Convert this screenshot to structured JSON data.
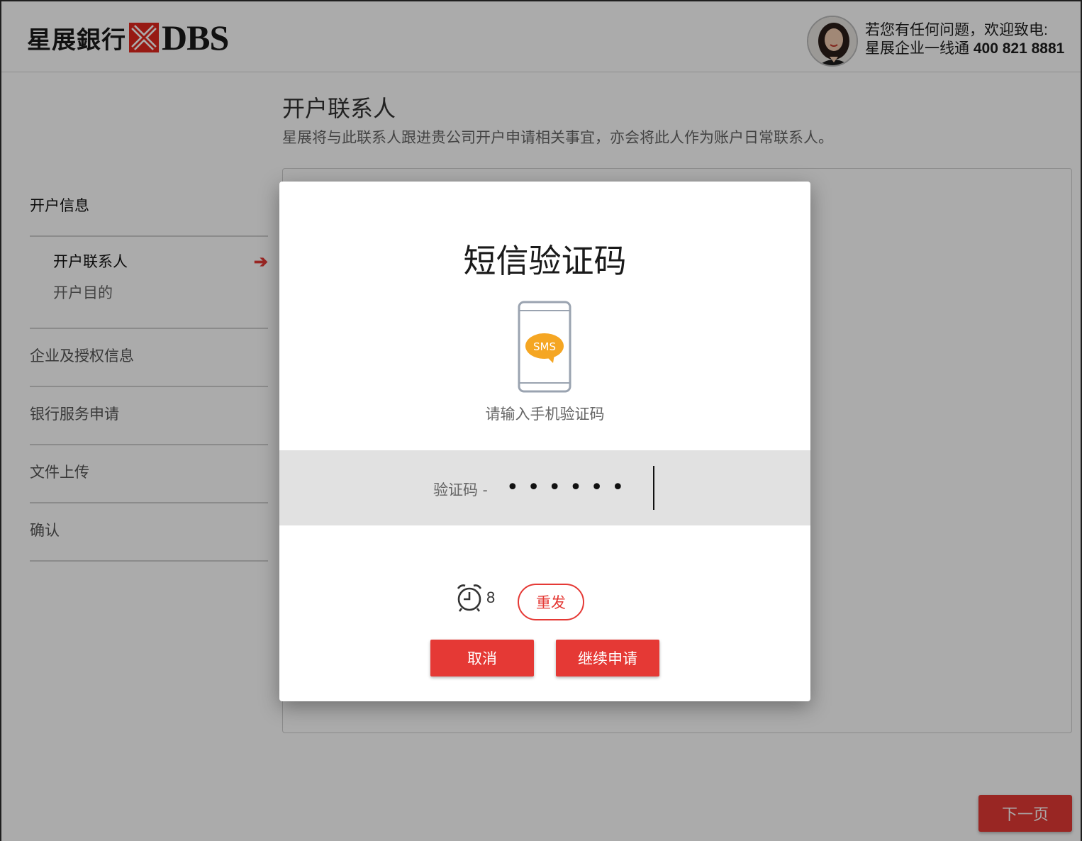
{
  "header": {
    "logo_cn": "星展銀行",
    "logo_en": "DBS",
    "contact_line1": "若您有任何问题，欢迎致电:",
    "contact_line2_prefix": "星展企业一线通",
    "contact_phone": "400 821 8881"
  },
  "page": {
    "title": "开户联系人",
    "subtitle": "星展将与此联系人跟进贵公司开户申请相关事宜，亦会将此人作为账户日常联系人。",
    "next_button": "下一页"
  },
  "sidebar": {
    "sections": [
      {
        "label": "开户信息",
        "active": true
      },
      {
        "label": "企业及授权信息"
      },
      {
        "label": "银行服务申请"
      },
      {
        "label": "文件上传"
      },
      {
        "label": "确认"
      }
    ],
    "sub_items": [
      {
        "label": "开户联系人",
        "current": true
      },
      {
        "label": "开户目的"
      }
    ]
  },
  "modal": {
    "title": "短信验证码",
    "sms_badge": "SMS",
    "prompt": "请输入手机验证码",
    "code_label": "验证码 -",
    "code_value": "••••••",
    "timer_count": "8",
    "resend_button": "重发",
    "cancel_button": "取消",
    "continue_button": "继续申请"
  },
  "colors": {
    "accent": "#e53935",
    "overlay": "rgba(0,0,0,0.33)",
    "sms_bubble": "#f5a623"
  },
  "icons": [
    "dbs-x-logo-icon",
    "avatar",
    "arrow-right-icon",
    "phone-sms-icon",
    "alarm-clock-icon"
  ]
}
